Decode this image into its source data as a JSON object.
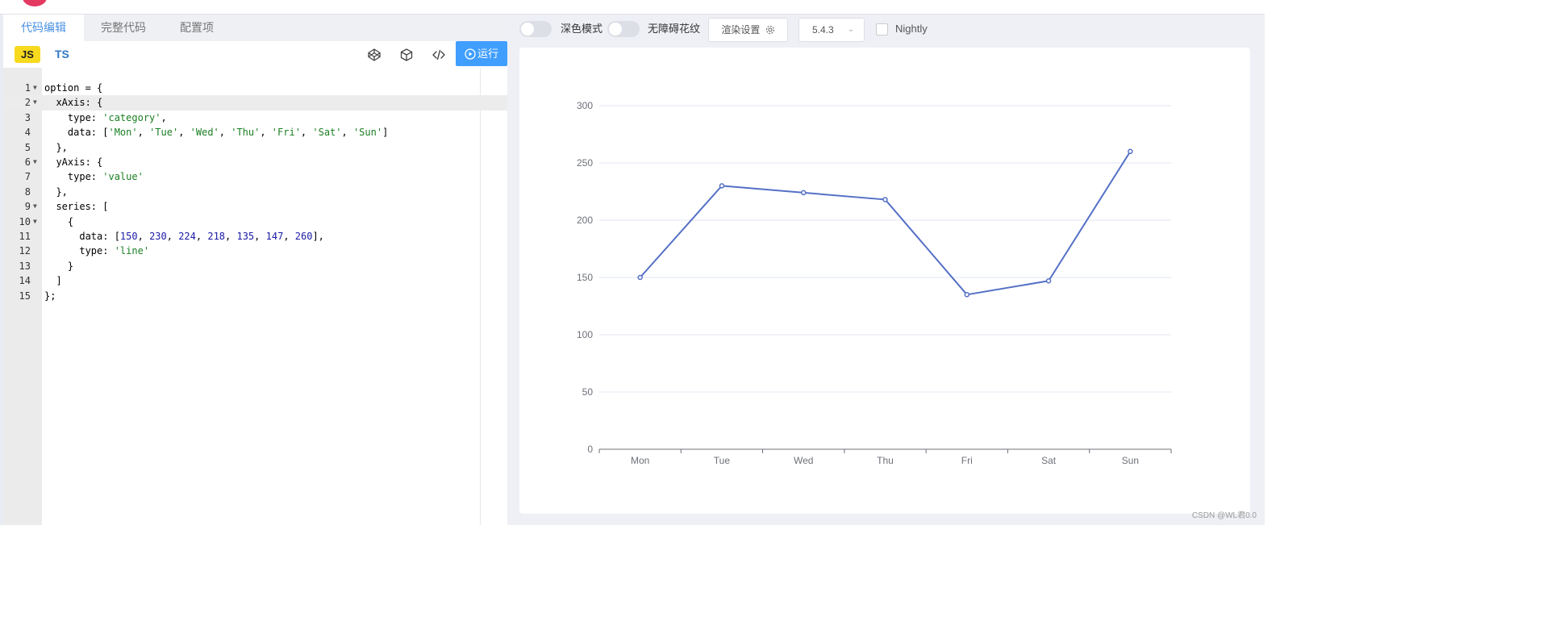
{
  "tabs": [
    {
      "label": "代码编辑",
      "active": true
    },
    {
      "label": "完整代码",
      "active": false
    },
    {
      "label": "配置项",
      "active": false
    }
  ],
  "lang": {
    "js": "JS",
    "ts": "TS"
  },
  "toolbar": {
    "icons": [
      "codepen-icon",
      "package-icon",
      "embed-code-icon"
    ],
    "run_label": "运行"
  },
  "code_lines": [
    {
      "num": "1",
      "fold": true,
      "html": "option = {"
    },
    {
      "num": "2",
      "fold": true,
      "html": "  xAxis: {"
    },
    {
      "num": "3",
      "fold": false,
      "html": "    type: <span class='s'>'category'</span>,"
    },
    {
      "num": "4",
      "fold": false,
      "html": "    data: [<span class='s'>'Mon'</span>, <span class='s'>'Tue'</span>, <span class='s'>'Wed'</span>, <span class='s'>'Thu'</span>, <span class='s'>'Fri'</span>, <span class='s'>'Sat'</span>, <span class='s'>'Sun'</span>]"
    },
    {
      "num": "5",
      "fold": false,
      "html": "  },"
    },
    {
      "num": "6",
      "fold": true,
      "html": "  yAxis: {"
    },
    {
      "num": "7",
      "fold": false,
      "html": "    type: <span class='s'>'value'</span>"
    },
    {
      "num": "8",
      "fold": false,
      "html": "  },"
    },
    {
      "num": "9",
      "fold": true,
      "html": "  series: ["
    },
    {
      "num": "10",
      "fold": true,
      "html": "    {"
    },
    {
      "num": "11",
      "fold": false,
      "html": "      data: [<span class='n'>150</span>, <span class='n'>230</span>, <span class='n'>224</span>, <span class='n'>218</span>, <span class='n'>135</span>, <span class='n'>147</span>, <span class='n'>260</span>],"
    },
    {
      "num": "12",
      "fold": false,
      "html": "      type: <span class='s'>'line'</span>"
    },
    {
      "num": "13",
      "fold": false,
      "html": "    }"
    },
    {
      "num": "14",
      "fold": false,
      "html": "  ]"
    },
    {
      "num": "15",
      "fold": false,
      "html": "};"
    }
  ],
  "preview_controls": {
    "dark_mode_label": "深色模式",
    "aria_label": "无障碍花纹",
    "render_settings_label": "渲染设置",
    "version": "5.4.3",
    "nightly_label": "Nightly"
  },
  "chart_data": {
    "type": "line",
    "categories": [
      "Mon",
      "Tue",
      "Wed",
      "Thu",
      "Fri",
      "Sat",
      "Sun"
    ],
    "series": [
      {
        "values": [
          150,
          230,
          224,
          218,
          135,
          147,
          260
        ]
      }
    ],
    "ylim": [
      0,
      300
    ],
    "yticks": [
      0,
      50,
      100,
      150,
      200,
      250,
      300
    ],
    "color": "#5470c6",
    "grid": true
  },
  "watermark": "CSDN @WL君0.0"
}
